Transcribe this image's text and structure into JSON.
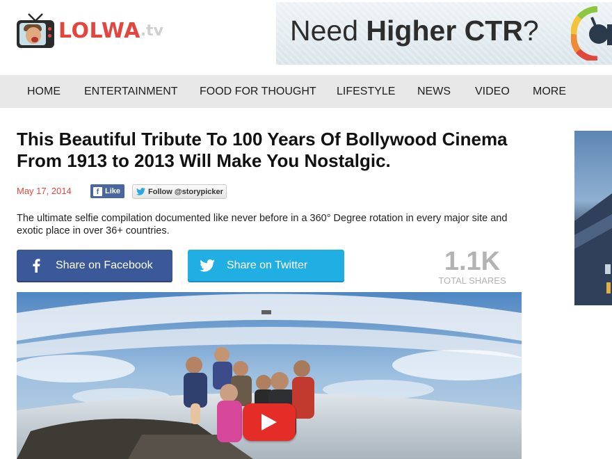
{
  "site": {
    "logo_name": "LOLWA",
    "logo_tld": ".tv"
  },
  "ad": {
    "text_light": "Need ",
    "text_bold": "Higher CTR",
    "text_end": "?"
  },
  "nav": {
    "items": [
      {
        "label": "HOME"
      },
      {
        "label": "ENTERTAINMENT"
      },
      {
        "label": "FOOD FOR THOUGHT"
      },
      {
        "label": "LIFESTYLE"
      },
      {
        "label": "NEWS"
      },
      {
        "label": "VIDEO"
      },
      {
        "label": "MORE"
      }
    ]
  },
  "article": {
    "title": "This Beautiful Tribute To 100 Years Of Bollywood Cinema From 1913 to 2013 Will Make You Nostalgic.",
    "date": "May 17, 2014",
    "fb_like_label": "Like",
    "twitter_follow_label": "Follow @storypicker",
    "summary": "The ultimate selfie compilation documented like never before in a 360° Degree rotation in every major site and exotic place in over 36+ countries."
  },
  "share": {
    "facebook_label": "Share on Facebook",
    "twitter_label": "Share on Twitter",
    "count": "1.1K",
    "count_label": "TOTAL SHARES"
  },
  "colors": {
    "brand_red": "#e2473f",
    "facebook_blue": "#3b5998",
    "twitter_blue": "#20aee3",
    "youtube_red": "#e52d27"
  },
  "icons": {
    "logo": "tv-icon",
    "facebook": "facebook-f-icon",
    "twitter": "twitter-bird-icon",
    "video": "play-icon",
    "ad": "gauge-icon"
  }
}
